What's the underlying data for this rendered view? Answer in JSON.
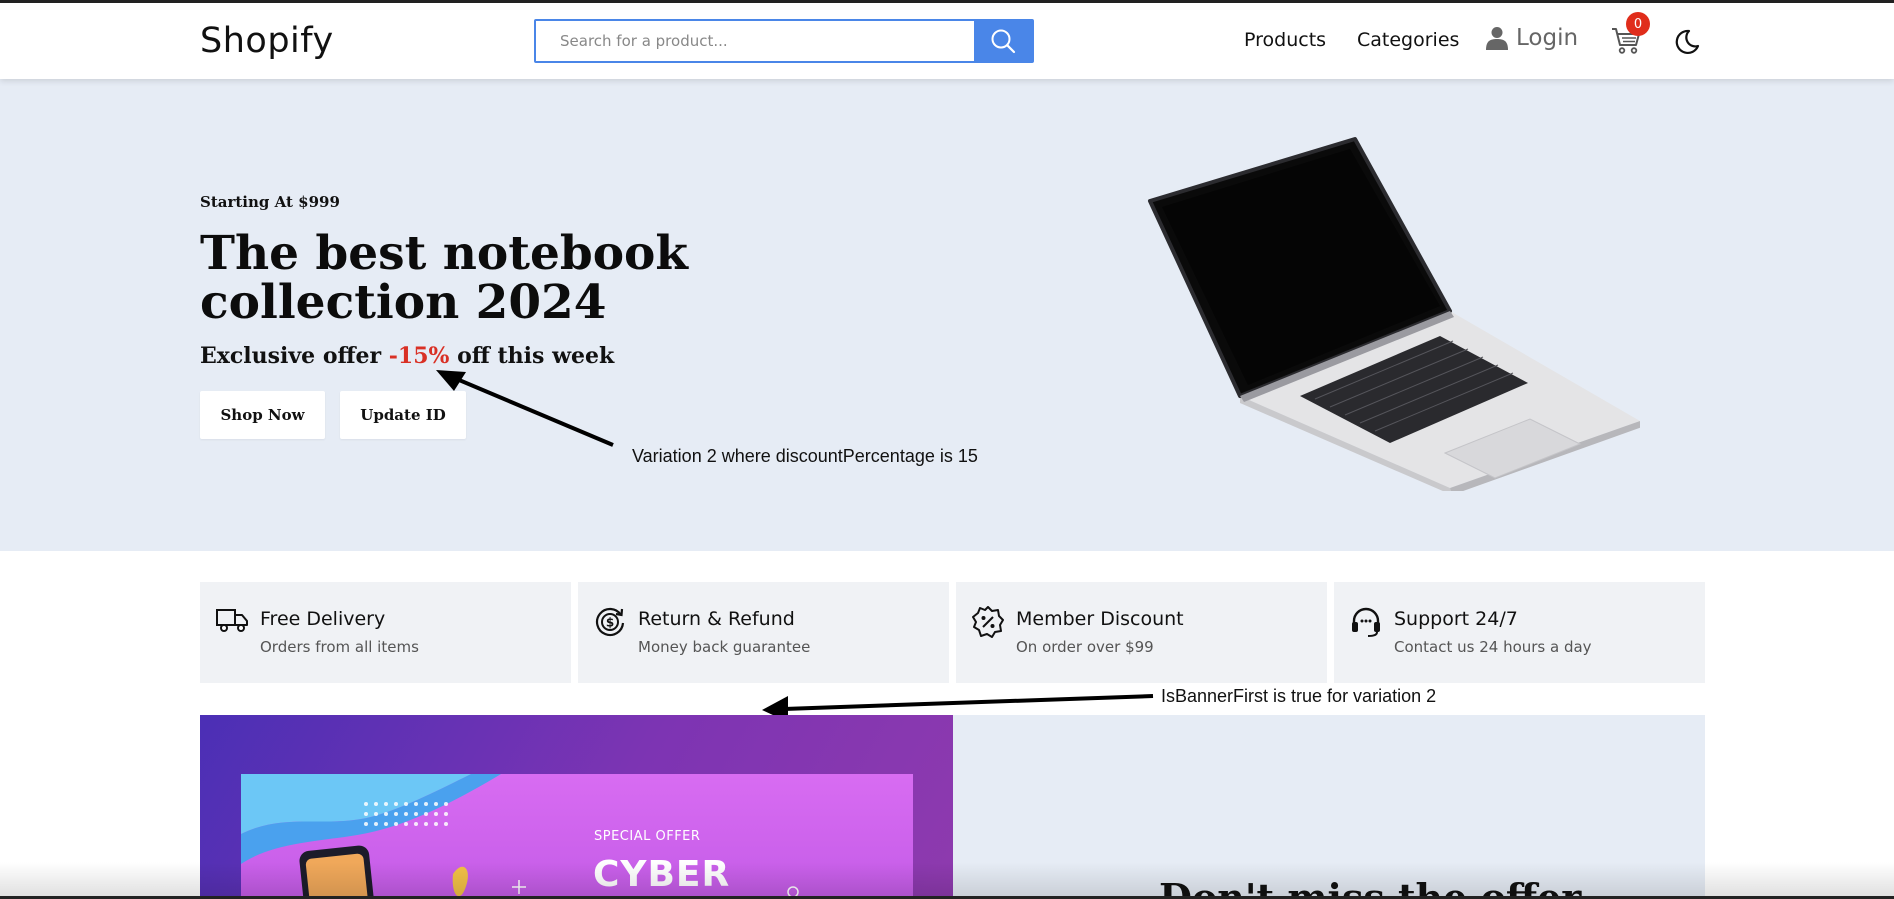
{
  "header": {
    "logo": "Shopify",
    "search_placeholder": "Search for a product...",
    "nav": {
      "products": "Products",
      "categories": "Categories",
      "login": "Login"
    },
    "cart_count": "0"
  },
  "hero": {
    "pretitle": "Starting At $999",
    "title": "The best notebook collection 2024",
    "offer_prefix": "Exclusive offer ",
    "offer_pct": "-15%",
    "offer_suffix": " off this week",
    "shop_now": "Shop Now",
    "update_id": "Update ID",
    "annotation": "Variation 2 where discountPercentage is 15"
  },
  "features": [
    {
      "icon": "truck-icon",
      "title": "Free Delivery",
      "sub": "Orders from all items"
    },
    {
      "icon": "dollar-refund-icon",
      "title": "Return & Refund",
      "sub": "Money back guarantee"
    },
    {
      "icon": "discount-badge-icon",
      "title": "Member Discount",
      "sub": "On order over $99"
    },
    {
      "icon": "headset-icon",
      "title": "Support 24/7",
      "sub": "Contact us 24 hours a day"
    }
  ],
  "annotation2": "IsBannerFirst is true for variation 2",
  "promo": {
    "special": "SPECIAL OFFER",
    "cyber": "CYBER",
    "dont_miss": "Don't miss the offer"
  },
  "colors": {
    "accent": "#4a86e8",
    "badge": "#e02d1b",
    "hero_bg": "#e6ecf5",
    "discount": "#d93025"
  }
}
